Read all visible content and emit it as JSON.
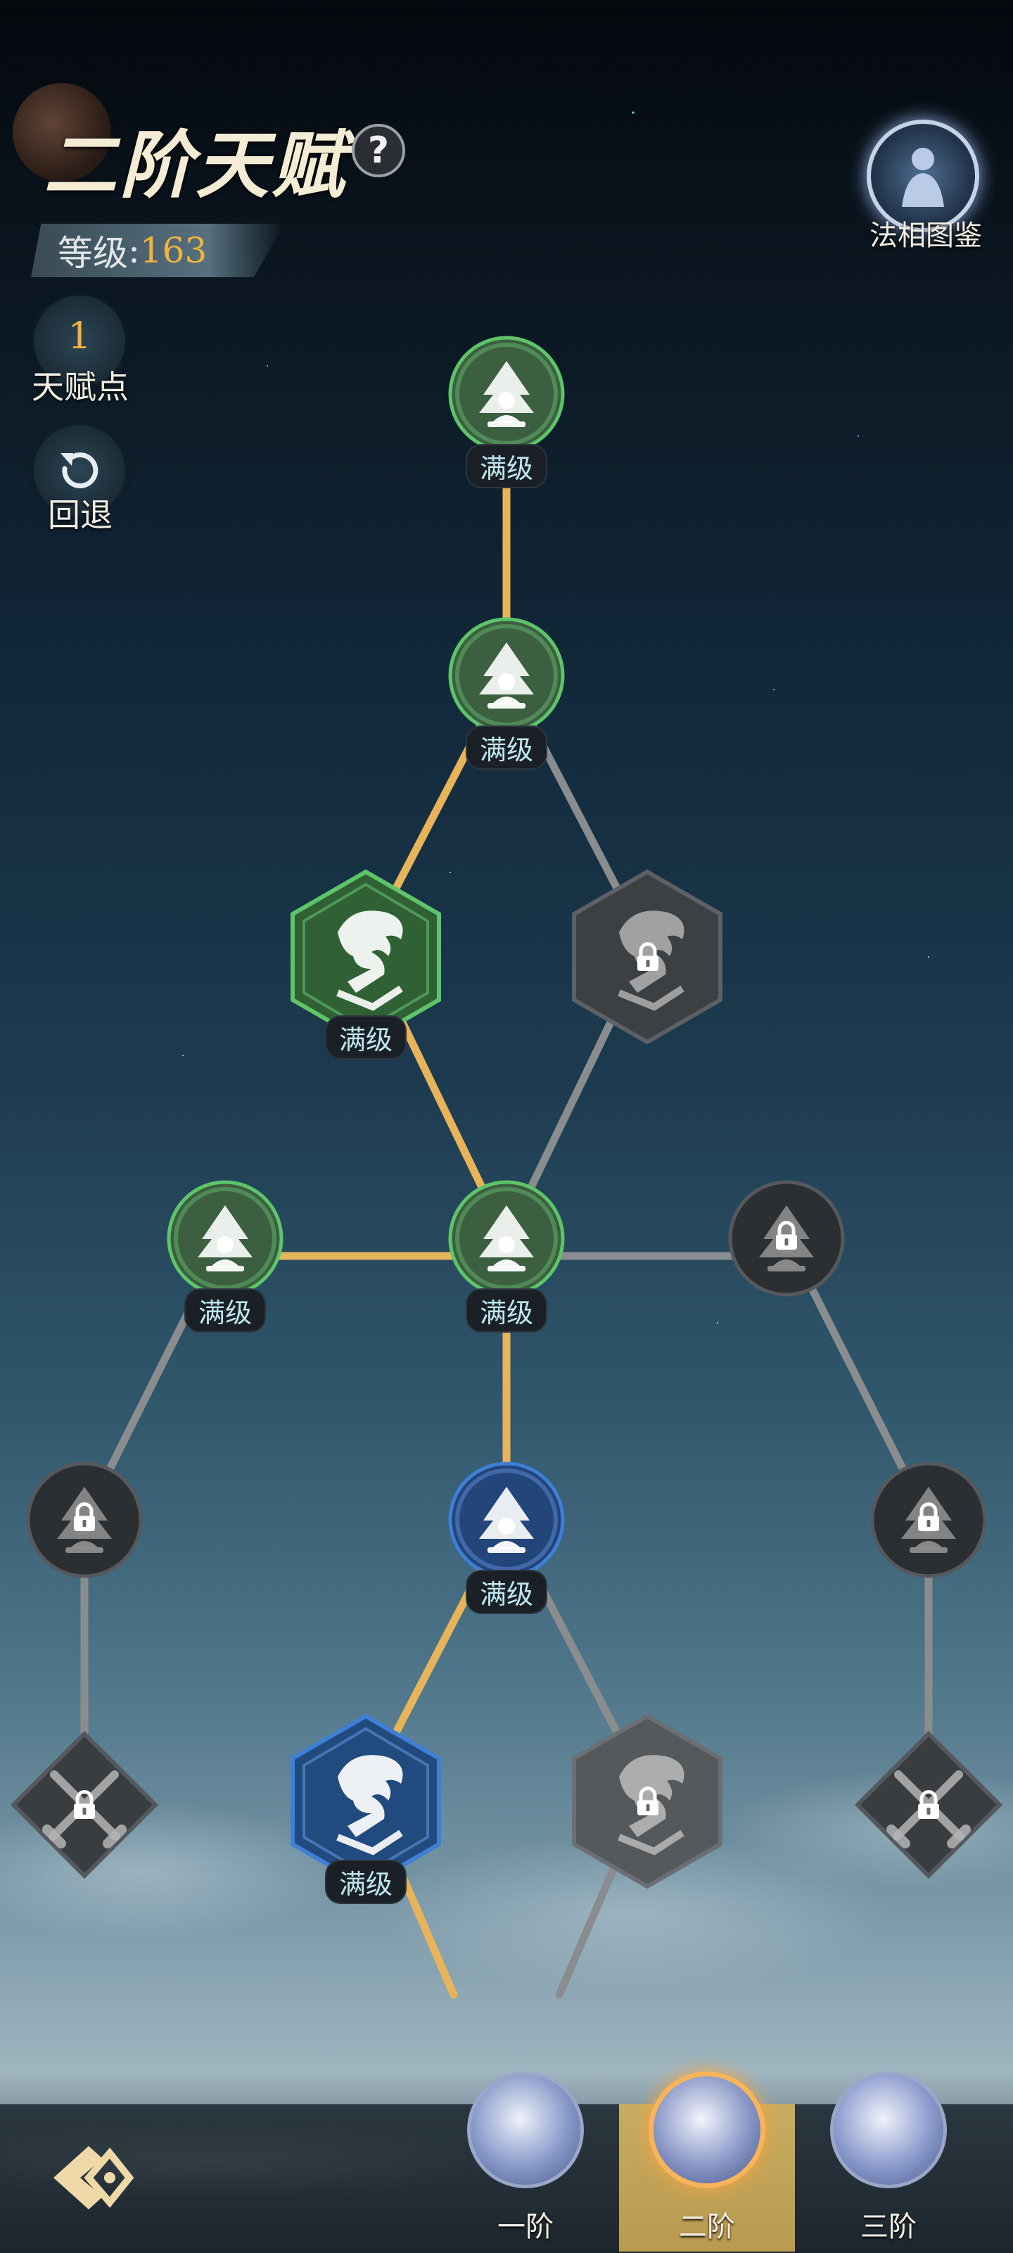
{
  "header": {
    "title": "二阶天赋",
    "help_icon": "?",
    "level_label": "等级",
    "level_sep": ":",
    "level_value": "163"
  },
  "talent_points": {
    "value": "1",
    "label": "天赋点"
  },
  "undo": {
    "label": "回退"
  },
  "codex": {
    "label": "法相图鉴"
  },
  "nodes": {
    "n1": {
      "label": "满级",
      "state": "maxed"
    },
    "n2": {
      "label": "满级",
      "state": "maxed"
    },
    "n3": {
      "label": "满级",
      "state": "maxed",
      "icon": "dragon-icon"
    },
    "n4": {
      "state": "locked",
      "icon": "dragon-icon"
    },
    "n5": {
      "label": "满级",
      "state": "maxed"
    },
    "n6": {
      "label": "满级",
      "state": "maxed"
    },
    "n7": {
      "state": "locked"
    },
    "n8": {
      "state": "locked"
    },
    "n9": {
      "label": "满级",
      "state": "maxed-blue"
    },
    "n10": {
      "state": "locked"
    },
    "n11": {
      "state": "locked",
      "icon": "swords-icon"
    },
    "n12": {
      "label": "满级",
      "state": "maxed-blue",
      "icon": "dragon-icon"
    },
    "n13": {
      "state": "locked",
      "icon": "dragon-icon"
    },
    "n14": {
      "state": "locked",
      "icon": "swords-icon"
    }
  },
  "tiers": [
    {
      "label": "一阶",
      "active": false
    },
    {
      "label": "二阶",
      "active": true
    },
    {
      "label": "三阶",
      "active": false
    }
  ],
  "colors": {
    "active_line": "#e8b45a",
    "inactive_line": "#8a8d90",
    "green_glow": "#5ec46a",
    "blue_glow": "#3f7fd6",
    "gold": "#f2b33d"
  }
}
